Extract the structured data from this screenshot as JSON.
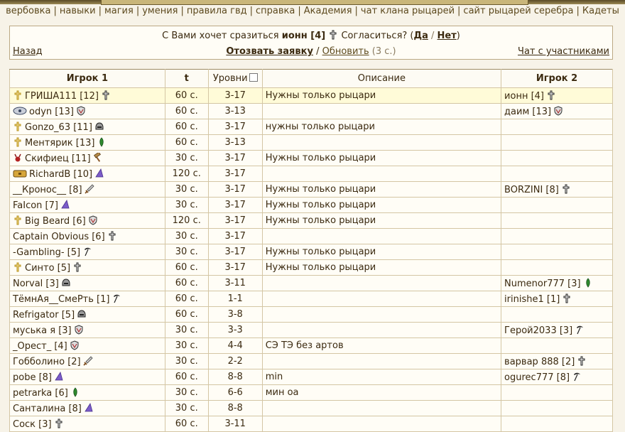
{
  "nav": {
    "items": [
      "вербовка",
      "навыки",
      "магия",
      "умения",
      "правила гвд",
      "справка",
      "Академия",
      "чат клана рыцарей",
      "сайт рыцарей серебра",
      "Кадеты"
    ]
  },
  "challenge": {
    "prefix": "С Вами хочет сразиться",
    "opponent": "ионн [4]",
    "icon": "cross",
    "question": "Согласиться? (",
    "yes": "Да",
    "slash": "/",
    "no": "Нет",
    "close": ")"
  },
  "actions": {
    "back": "Назад",
    "revoke": "Отозвать заявку",
    "refresh": "Обновить",
    "secs": "(3 с.)",
    "chat": "Чат с участниками"
  },
  "table": {
    "headers": {
      "player1": "Игрок 1",
      "t": "t",
      "levels": "Уровни",
      "desc": "Описание",
      "player2": "Игрок 2"
    },
    "rows": [
      {
        "lead": "cross-gold",
        "p1": "ГРИША111 [12]",
        "p1icon": "cross",
        "t": "60 с.",
        "lv": "3-17",
        "desc": "Нужны только рыцари",
        "p2": "ионн [4]",
        "p2icon": "cross",
        "highlight": true
      },
      {
        "lead": "ornate",
        "p1": "odyn [13]",
        "p1icon": "shield",
        "t": "60 с.",
        "lv": "3-13",
        "desc": "",
        "p2": "даим [13]",
        "p2icon": "shield"
      },
      {
        "lead": "cross-gold",
        "p1": "Gonzo_63 [11]",
        "p1icon": "helmet",
        "t": "60 с.",
        "lv": "3-17",
        "desc": "нужны только рыцари",
        "p2": "",
        "p2icon": ""
      },
      {
        "lead": "cross-gold",
        "p1": "Ментярик [13]",
        "p1icon": "leaf",
        "t": "60 с.",
        "lv": "3-13",
        "desc": "",
        "p2": "",
        "p2icon": ""
      },
      {
        "lead": "demon",
        "p1": "Скифиец [11]",
        "p1icon": "hammer",
        "t": "30 с.",
        "lv": "3-17",
        "desc": "Нужны только рыцари",
        "p2": "",
        "p2icon": ""
      },
      {
        "lead": "chest",
        "p1": "RichardB [10]",
        "p1icon": "wizard",
        "t": "120 с.",
        "lv": "3-17",
        "desc": "",
        "p2": "",
        "p2icon": ""
      },
      {
        "lead": "",
        "p1": "__Кронос__ [8]",
        "p1icon": "sword",
        "t": "30 с.",
        "lv": "3-17",
        "desc": "Нужны только рыцари",
        "p2": "BORZINI [8]",
        "p2icon": "cross"
      },
      {
        "lead": "",
        "p1": "FaIcon [7]",
        "p1icon": "wizard",
        "t": "30 с.",
        "lv": "3-17",
        "desc": "Нужны только рыцари",
        "p2": "",
        "p2icon": ""
      },
      {
        "lead": "cross-gold",
        "p1": "Big Beard [6]",
        "p1icon": "shield",
        "t": "120 с.",
        "lv": "3-17",
        "desc": "Нужны только рыцари",
        "p2": "",
        "p2icon": ""
      },
      {
        "lead": "",
        "p1": "Captain Obvious [6]",
        "p1icon": "cross",
        "t": "30 с.",
        "lv": "3-17",
        "desc": "",
        "p2": "",
        "p2icon": ""
      },
      {
        "lead": "",
        "p1": "-Gambling- [5]",
        "p1icon": "scythe",
        "t": "30 с.",
        "lv": "3-17",
        "desc": "Нужны только рыцари",
        "p2": "",
        "p2icon": ""
      },
      {
        "lead": "cross-gold",
        "p1": "Синто [5]",
        "p1icon": "cross",
        "t": "60 с.",
        "lv": "3-17",
        "desc": "Нужны только рыцари",
        "p2": "",
        "p2icon": ""
      },
      {
        "lead": "",
        "p1": "Norval [3]",
        "p1icon": "helmet",
        "t": "60 с.",
        "lv": "3-11",
        "desc": "",
        "p2": "Numenor777 [3]",
        "p2icon": "leaf"
      },
      {
        "lead": "",
        "p1": "ТёмнАя__СмеРть [1]",
        "p1icon": "scythe",
        "t": "60 с.",
        "lv": "1-1",
        "desc": "",
        "p2": "irinishe1 [1]",
        "p2icon": "cross"
      },
      {
        "lead": "",
        "p1": "Refrigator [5]",
        "p1icon": "helmet",
        "t": "60 с.",
        "lv": "3-8",
        "desc": "",
        "p2": "",
        "p2icon": ""
      },
      {
        "lead": "",
        "p1": "муська я [3]",
        "p1icon": "shield",
        "t": "30 с.",
        "lv": "3-3",
        "desc": "",
        "p2": "Герой2033 [3]",
        "p2icon": "scythe"
      },
      {
        "lead": "",
        "p1": "_Орест_ [4]",
        "p1icon": "shield",
        "t": "30 с.",
        "lv": "4-4",
        "desc": "СЭ ТЭ без артов",
        "p2": "",
        "p2icon": ""
      },
      {
        "lead": "",
        "p1": "Гобболино [2]",
        "p1icon": "sword",
        "t": "30 с.",
        "lv": "2-2",
        "desc": "",
        "p2": "варвар 888 [2]",
        "p2icon": "cross"
      },
      {
        "lead": "",
        "p1": "pobe [8]",
        "p1icon": "wizard",
        "t": "60 с.",
        "lv": "8-8",
        "desc": "min",
        "p2": "ogurec777 [8]",
        "p2icon": "scythe"
      },
      {
        "lead": "",
        "p1": "petrarka [6]",
        "p1icon": "leaf",
        "t": "30 с.",
        "lv": "6-6",
        "desc": "мин оа",
        "p2": "",
        "p2icon": ""
      },
      {
        "lead": "",
        "p1": "Санталина [8]",
        "p1icon": "wizard",
        "t": "30 с.",
        "lv": "8-8",
        "desc": "",
        "p2": "",
        "p2icon": ""
      },
      {
        "lead": "",
        "p1": "Соск [3]",
        "p1icon": "cross",
        "t": "60 с.",
        "lv": "3-11",
        "desc": "",
        "p2": "",
        "p2icon": ""
      }
    ]
  }
}
